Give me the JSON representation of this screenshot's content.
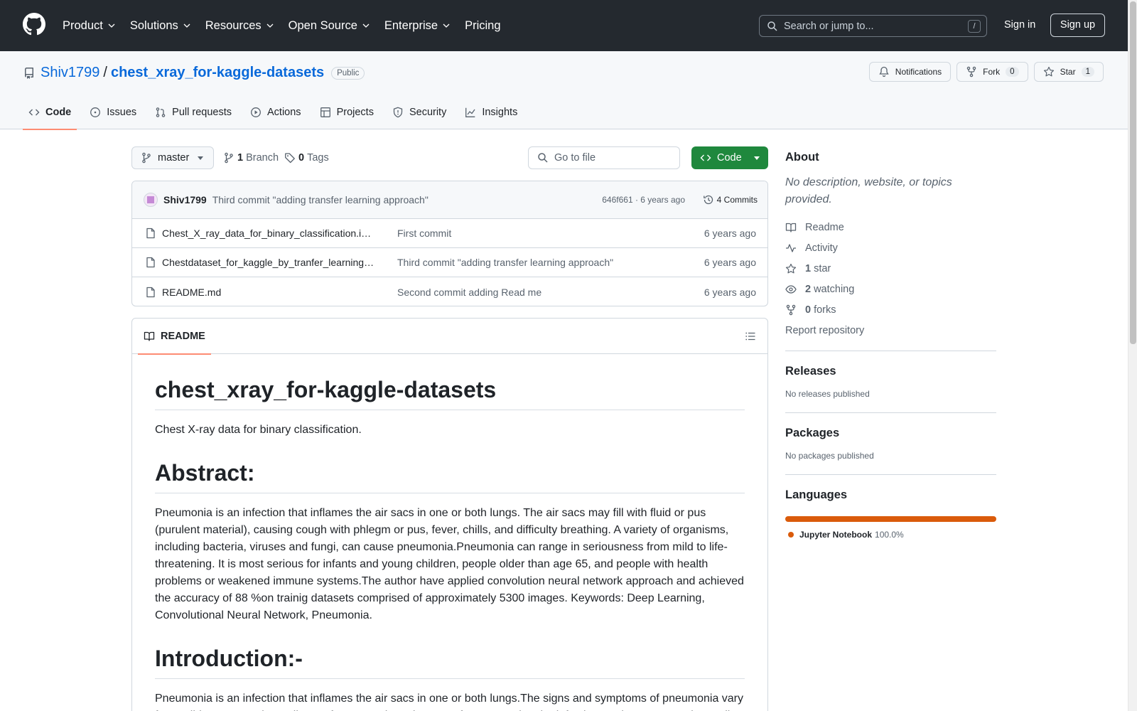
{
  "topnav": {
    "items": [
      {
        "label": "Product",
        "dropdown": true
      },
      {
        "label": "Solutions",
        "dropdown": true
      },
      {
        "label": "Resources",
        "dropdown": true
      },
      {
        "label": "Open Source",
        "dropdown": true
      },
      {
        "label": "Enterprise",
        "dropdown": true
      },
      {
        "label": "Pricing",
        "dropdown": false
      }
    ],
    "search_placeholder": "Search or jump to...",
    "search_shortcut": "/",
    "signin": "Sign in",
    "signup": "Sign up"
  },
  "repo": {
    "owner": "Shiv1799",
    "separator": "/",
    "name": "chest_xray_for-kaggle-datasets",
    "visibility": "Public",
    "notifications_label": "Notifications",
    "fork_label": "Fork",
    "fork_count": "0",
    "star_label": "Star",
    "star_count": "1"
  },
  "tabs": [
    {
      "label": "Code",
      "icon": "code-icon",
      "active": true
    },
    {
      "label": "Issues",
      "icon": "issue-icon",
      "active": false
    },
    {
      "label": "Pull requests",
      "icon": "pull-request-icon",
      "active": false
    },
    {
      "label": "Actions",
      "icon": "play-icon",
      "active": false
    },
    {
      "label": "Projects",
      "icon": "table-icon",
      "active": false
    },
    {
      "label": "Security",
      "icon": "shield-icon",
      "active": false
    },
    {
      "label": "Insights",
      "icon": "graph-icon",
      "active": false
    }
  ],
  "toolbar": {
    "branch": "master",
    "branch_count": "1",
    "branch_label": "Branch",
    "tag_count": "0",
    "tag_label": "Tags",
    "goto_placeholder": "Go to file",
    "code_button": "Code"
  },
  "latest_commit": {
    "author": "Shiv1799",
    "message": "Third commit \"adding transfer learning approach\"",
    "meta": "646f661 · 6 years ago",
    "commits_label": "4 Commits"
  },
  "files": [
    {
      "name": "Chest_X_ray_data_for_binary_classification.ipynb",
      "message": "First commit",
      "age": "6 years ago"
    },
    {
      "name": "Chestdataset_for_kaggle_by_tranfer_learning.ipynb",
      "message": "Third commit \"adding transfer learning approach\"",
      "age": "6 years ago"
    },
    {
      "name": "README.md",
      "message": "Second commit adding Read me",
      "age": "6 years ago"
    }
  ],
  "readme": {
    "tab_label": "README",
    "title": "chest_xray_for-kaggle-datasets",
    "intro": "Chest X-ray data for binary classification.",
    "abstract_heading": "Abstract:",
    "abstract_text": "Pneumonia is an infection that inflames the air sacs in one or both lungs. The air sacs may fill with fluid or pus (purulent material), causing cough with phlegm or pus, fever, chills, and difficulty breathing. A variety of organisms, including bacteria, viruses and fungi, can cause pneumonia.Pneumonia can range in seriousness from mild to life-threatening. It is most serious for infants and young children, people older than age 65, and people with health problems or weakened immune systems.The author have applied convolution neural network approach and achieved the accuracy of 88 %on trainig datasets comprised of approximately 5300 images. Keywords: Deep Learning, Convolutional Neural Network, Pneumonia.",
    "introduction_heading": "Introduction:-",
    "introduction_text": "Pneumonia is an infection that inflames the air sacs in one or both lungs.The signs and symptoms of pneumonia vary from mild to severe, depending on factors such as the type of germ causing the infection, and your age and overall health."
  },
  "sidebar": {
    "about_heading": "About",
    "about_desc": "No description, website, or topics provided.",
    "links": [
      {
        "icon": "book-icon",
        "count": "",
        "label": "Readme"
      },
      {
        "icon": "pulse-icon",
        "count": "",
        "label": "Activity"
      },
      {
        "icon": "star-icon",
        "count": "1",
        "label": "star"
      },
      {
        "icon": "eye-icon",
        "count": "2",
        "label": "watching"
      },
      {
        "icon": "fork-icon",
        "count": "0",
        "label": "forks"
      }
    ],
    "report": "Report repository",
    "releases_heading": "Releases",
    "releases_text": "No releases published",
    "packages_heading": "Packages",
    "packages_text": "No packages published",
    "languages_heading": "Languages",
    "languages": [
      {
        "name": "Jupyter Notebook",
        "percent": "100.0%",
        "color": "#DA5B0B"
      }
    ]
  },
  "colors": {
    "header_bg": "#24292f",
    "link": "#0969da",
    "primary_button": "#1f883d",
    "tab_underline": "#fd8c73"
  }
}
